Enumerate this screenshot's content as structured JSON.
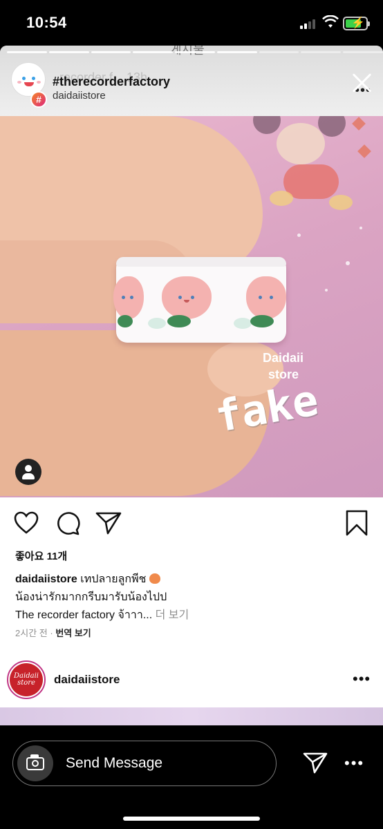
{
  "status_bar": {
    "time": "10:54"
  },
  "story": {
    "header_faint_text": "게시물",
    "title": "#therecorderfactory",
    "title_ghost": "recorder f... 13h",
    "subtitle": "daidaiistore"
  },
  "photo": {
    "watermark_line1": "Daidaii",
    "watermark_line2": "store",
    "overlay_text": "fake"
  },
  "post": {
    "likes": "좋아요 11개",
    "caption_user": "daidaiistore",
    "caption_line1": "เทปลายลูกพีช",
    "caption_line2": "น้องน่ารักมากกรีบมารับน้องไปป",
    "caption_line3": "The recorder factory จ้าาา...",
    "more_label": "더 보기",
    "time_ago": "2시간 전",
    "translate_label": "번역 보기"
  },
  "next_post": {
    "username": "daidaiistore",
    "avatar_text": "Daidaii store"
  },
  "bottom_bar": {
    "send_placeholder": "Send Message"
  },
  "icons": {
    "story_close": "close-icon",
    "like": "heart-icon",
    "comment": "comment-icon",
    "share": "paper-plane-icon",
    "save": "bookmark-icon",
    "camera": "camera-icon",
    "send": "paper-plane-icon",
    "more": "ellipsis-icon"
  },
  "colors": {
    "background": "#000000",
    "battery_charge": "#3cd14a",
    "hashtag_badge": "#dd2a7b",
    "story_ring": "#c13584"
  }
}
